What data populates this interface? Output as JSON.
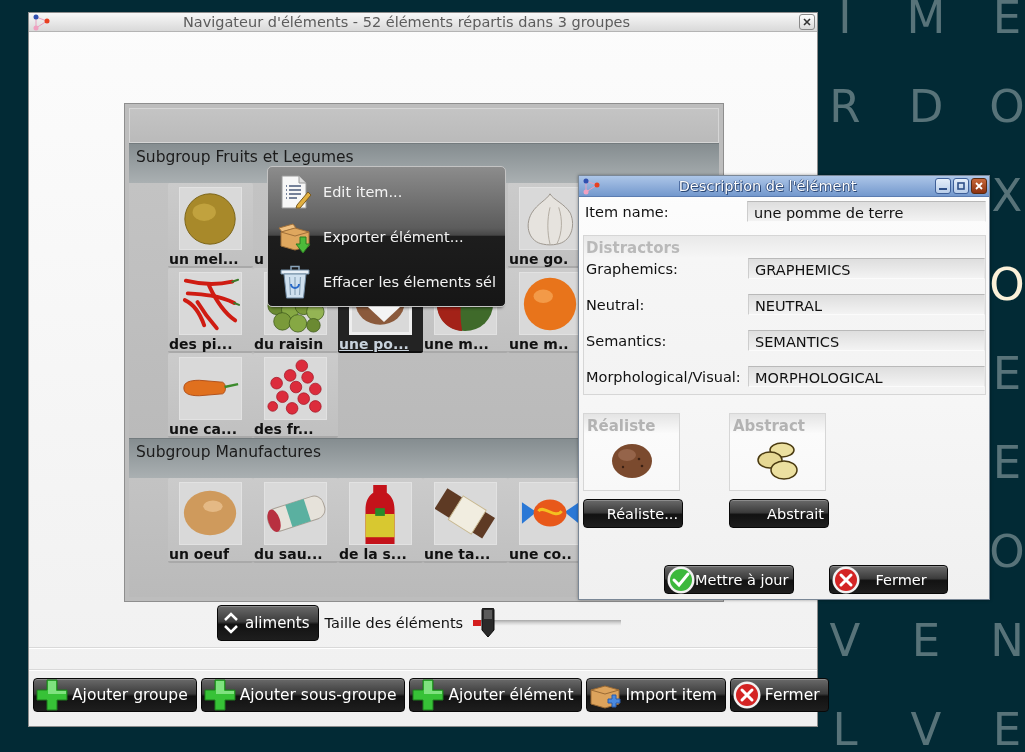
{
  "desktop": {
    "letter_rows": [
      {
        "letters": [
          {
            "char": "I",
            "highlighted": false
          },
          {
            "char": "M",
            "highlighted": false
          },
          {
            "char": "E",
            "highlighted": false
          }
        ]
      },
      {
        "letters": [
          {
            "char": "R",
            "highlighted": false
          },
          {
            "char": "D",
            "highlighted": false
          },
          {
            "char": "O",
            "highlighted": false
          }
        ]
      },
      {
        "letters": [
          {
            "char": "X",
            "highlighted": false
          }
        ]
      },
      {
        "letters": [
          {
            "char": "O",
            "highlighted": true
          }
        ]
      },
      {
        "letters": [
          {
            "char": "E",
            "highlighted": false
          }
        ]
      },
      {
        "letters": [
          {
            "char": "E",
            "highlighted": false
          }
        ]
      },
      {
        "letters": [
          {
            "char": "O",
            "highlighted": false
          }
        ]
      },
      {
        "letters": [
          {
            "char": "V",
            "highlighted": false
          },
          {
            "char": "E",
            "highlighted": false
          },
          {
            "char": "N",
            "highlighted": false
          }
        ]
      },
      {
        "letters": [
          {
            "char": "L",
            "highlighted": false
          },
          {
            "char": "V",
            "highlighted": false
          },
          {
            "char": "E",
            "highlighted": false
          }
        ]
      }
    ]
  },
  "main_window": {
    "title": "Navigateur d'éléments - 52 éléments répartis dans 3 groupes",
    "groups": [
      {
        "title": "Subgroup Fruits et Legumes",
        "items": [
          {
            "kind": "melon",
            "label": "un mel...",
            "selected": false
          },
          {
            "kind": "covered",
            "label": "u",
            "selected": false
          },
          {
            "kind": "garlic",
            "label": "une go.",
            "selected": false
          },
          {
            "kind": "peppers",
            "label": "des pi...",
            "selected": false
          },
          {
            "kind": "grapes",
            "label": "du raisin",
            "selected": false
          },
          {
            "kind": "potato",
            "label": "une po...",
            "selected": true
          },
          {
            "kind": "mango",
            "label": "une m...",
            "selected": false
          },
          {
            "kind": "mandarin",
            "label": "une m..",
            "selected": false
          },
          {
            "kind": "carrot",
            "label": "une ca...",
            "selected": false
          },
          {
            "kind": "raspberries",
            "label": "des fr...",
            "selected": false
          }
        ]
      },
      {
        "title": "Subgroup Manufactures",
        "items": [
          {
            "kind": "egg",
            "label": "un oeuf",
            "selected": false
          },
          {
            "kind": "sausage",
            "label": "du sau...",
            "selected": false
          },
          {
            "kind": "bottle",
            "label": "de la s...",
            "selected": false
          },
          {
            "kind": "chocolate",
            "label": "une ta...",
            "selected": false
          },
          {
            "kind": "candy",
            "label": "une co..",
            "selected": false
          }
        ]
      }
    ],
    "context_menu": {
      "items": [
        {
          "kind": "edit",
          "label": "Edit item..."
        },
        {
          "kind": "export",
          "label": "Exporter élément..."
        },
        {
          "kind": "delete",
          "label": "Effacer les élements sél"
        }
      ]
    },
    "category_button": {
      "label": "aliments"
    },
    "size_label": "Taille des éléments",
    "size_slider": {
      "level": 0.1
    },
    "buttons": [
      {
        "kind": "add",
        "label": "Ajouter groupe"
      },
      {
        "kind": "add",
        "label": "Ajouter sous-groupe"
      },
      {
        "kind": "add",
        "label": "Ajouter élément"
      },
      {
        "kind": "import",
        "label": "Import item"
      },
      {
        "kind": "close",
        "label": "Fermer"
      }
    ]
  },
  "dialog": {
    "title": "Description de l'élément",
    "item_name": {
      "label": "Item name:",
      "value": "une pomme de terre"
    },
    "distractors": {
      "title": "Distractors",
      "fields": [
        {
          "label": "Graphemics:",
          "value": "GRAPHEMICS"
        },
        {
          "label": "Neutral:",
          "value": "NEUTRAL"
        },
        {
          "label": "Semantics:",
          "value": "SEMANTICS"
        },
        {
          "label": "Morphological/Visual:",
          "value": "MORPHOLOGICAL"
        }
      ]
    },
    "pictures": [
      {
        "kind": "realistic",
        "title": "Réaliste",
        "button": "Réaliste..."
      },
      {
        "kind": "abstract",
        "title": "Abstract",
        "button": "Abstrait"
      }
    ],
    "buttons": [
      {
        "kind": "confirm",
        "label": "Mettre à jour"
      },
      {
        "kind": "close",
        "label": "Fermer"
      }
    ]
  }
}
